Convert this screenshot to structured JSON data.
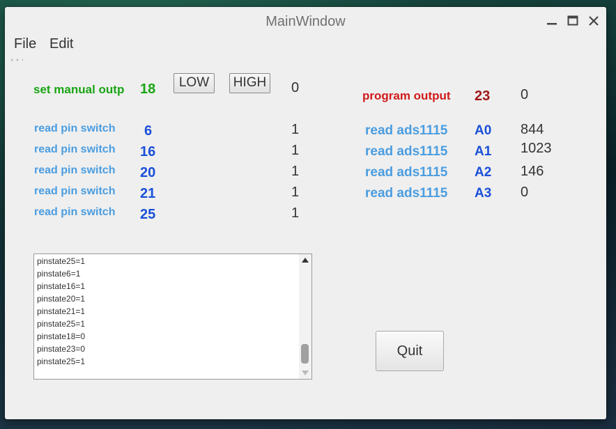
{
  "window": {
    "title": "MainWindow"
  },
  "menu": {
    "file": "File",
    "edit": "Edit"
  },
  "manual": {
    "label": "set manual outp",
    "pin": "18",
    "low_label": "LOW",
    "high_label": "HIGH",
    "value": "0"
  },
  "program": {
    "label": "program output",
    "pin": "23",
    "value": "0"
  },
  "pins": [
    {
      "label": "read pin switch",
      "pin": "6",
      "value": "1"
    },
    {
      "label": "read pin switch",
      "pin": "16",
      "value": "1"
    },
    {
      "label": "read pin switch",
      "pin": "20",
      "value": "1"
    },
    {
      "label": "read pin switch",
      "pin": "21",
      "value": "1"
    },
    {
      "label": "read pin switch",
      "pin": "25",
      "value": "1"
    }
  ],
  "ads": [
    {
      "label": "read ads1115",
      "channel": "A0",
      "value": "844"
    },
    {
      "label": "read ads1115",
      "channel": "A1",
      "value": "1023"
    },
    {
      "label": "read ads1115",
      "channel": "A2",
      "value": "146"
    },
    {
      "label": "read ads1115",
      "channel": "A3",
      "value": "0"
    }
  ],
  "log": [
    "pinstate25=1",
    "pinstate6=1",
    "pinstate16=1",
    "pinstate20=1",
    "pinstate21=1",
    "pinstate25=1",
    "pinstate18=0",
    "pinstate23=0",
    "pinstate25=1"
  ],
  "quit_label": "Quit"
}
